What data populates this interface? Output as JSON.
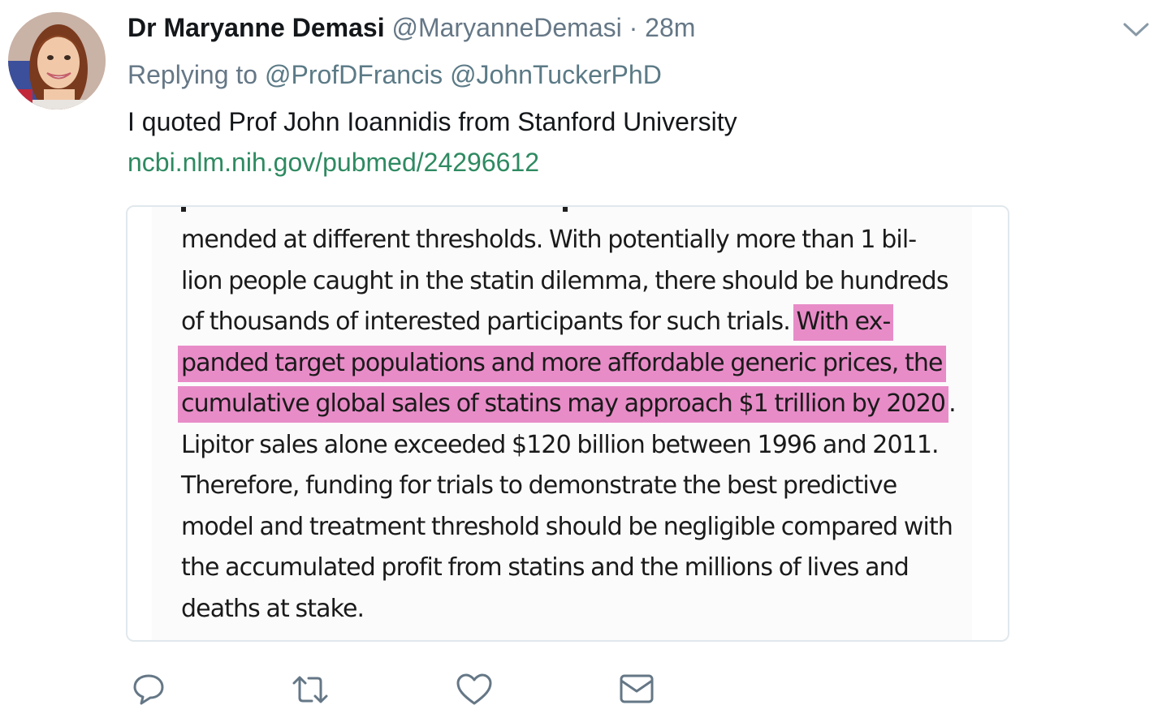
{
  "tweet": {
    "display_name": "Dr Maryanne Demasi",
    "handle": "@MaryanneDemasi",
    "separator": "·",
    "time": "28m",
    "replying_prefix": "Replying to",
    "replying_mentions": [
      "@ProfDFrancis",
      "@JohnTuckerPhD"
    ],
    "text": "I quoted Prof John Ioannidis from Stanford University",
    "link": "ncbi.nlm.nih.gov/pubmed/24296612"
  },
  "media": {
    "excerpt_lines": [
      {
        "plain": "mended at different thresholds. With potentially more than 1 bil-",
        "highlight": ""
      },
      {
        "plain": "lion people caught in the statin dilemma, there should be hundreds",
        "highlight": ""
      },
      {
        "plain": "of thousands of interested participants for such trials. ",
        "highlight": "With ex-"
      },
      {
        "plain": "",
        "highlight": "panded target populations and more affordable generic prices, the"
      },
      {
        "plain": ".",
        "highlight": "cumulative global sales of statins may approach $1 trillion by 2020"
      },
      {
        "plain": "Lipitor sales alone exceeded $120 billion between 1996 and 2011.",
        "highlight": ""
      },
      {
        "plain": "Therefore, funding for trials to demonstrate the best predictive",
        "highlight": ""
      },
      {
        "plain": "model and treatment threshold should be negligible compared with",
        "highlight": ""
      },
      {
        "plain": "the accumulated profit from statins and the millions of lives and",
        "highlight": ""
      },
      {
        "plain": "deaths at stake.",
        "highlight": ""
      }
    ],
    "highlight_color": "#e88cc8"
  },
  "icons": {
    "avatar": "avatar-photo",
    "caret": "chevron-down-icon",
    "reply": "reply-icon",
    "retweet": "retweet-icon",
    "like": "heart-icon",
    "dm": "envelope-icon"
  },
  "colors": {
    "name": "#14171a",
    "secondary": "#657786",
    "link": "#2e8a61",
    "highlight": "#e88cc8"
  }
}
